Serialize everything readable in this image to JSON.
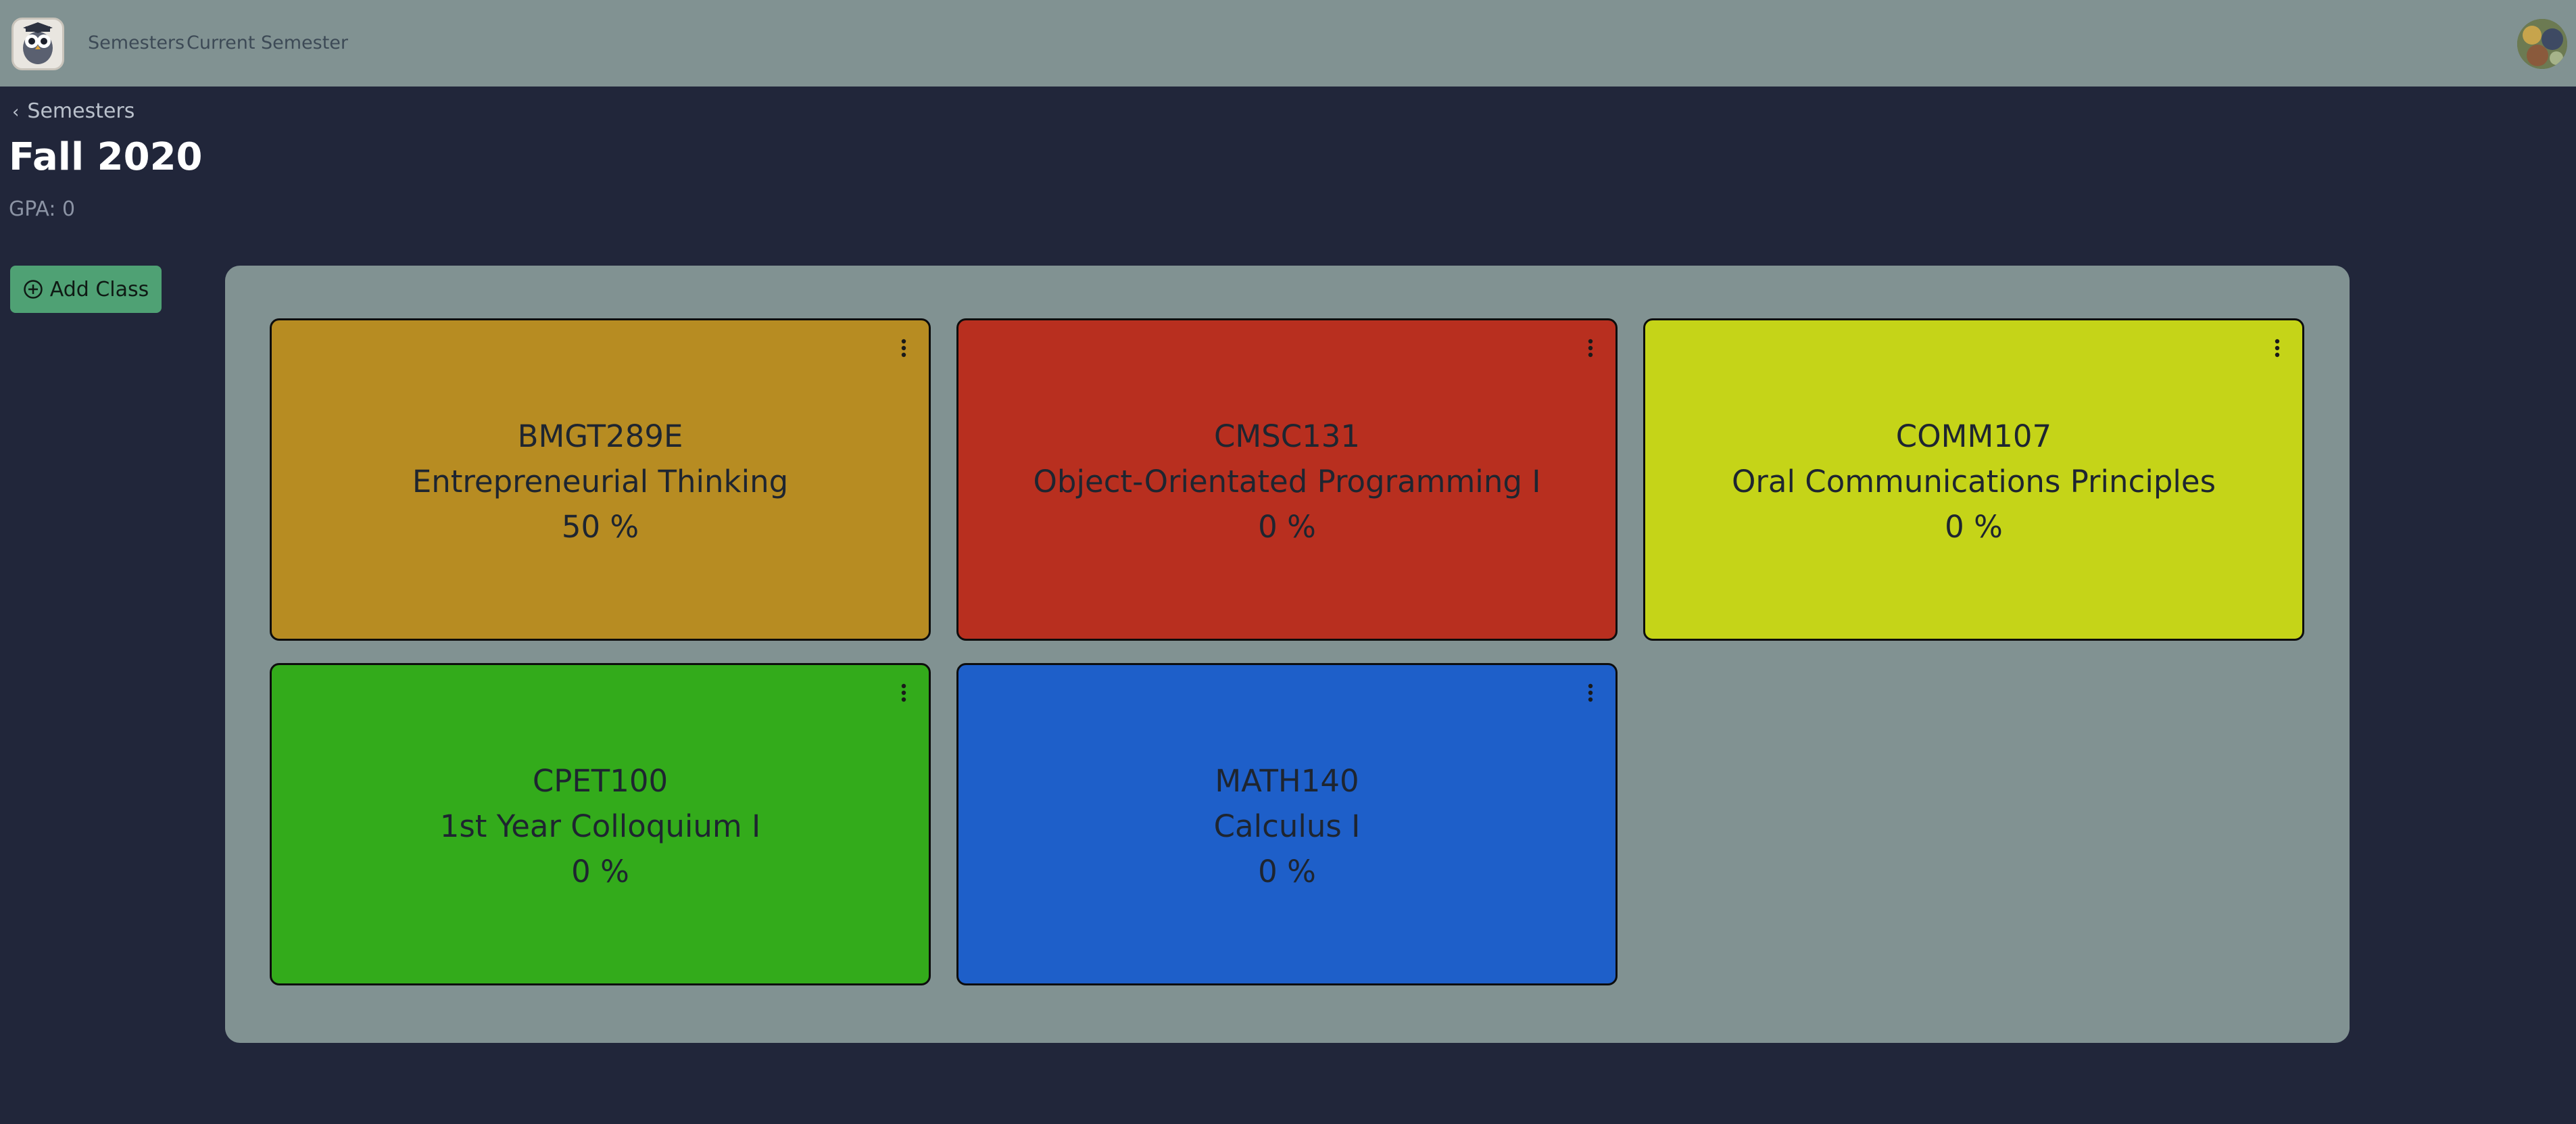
{
  "nav": {
    "links": [
      "Semesters",
      "Current Semester"
    ]
  },
  "breadcrumb": {
    "label": "Semesters"
  },
  "page": {
    "title": "Fall 2020",
    "gpa": "GPA: 0"
  },
  "actions": {
    "add_class_label": "Add Class"
  },
  "classes": [
    {
      "code": "BMGT289E",
      "name": "Entrepreneurial Thinking",
      "grade": "50 %",
      "color": "#b78c22"
    },
    {
      "code": "CMSC131",
      "name": "Object-Orientated Programming I",
      "grade": "0 %",
      "color": "#b82f1f"
    },
    {
      "code": "COMM107",
      "name": "Oral Communications Principles",
      "grade": "0 %",
      "color": "#c5d418"
    },
    {
      "code": "CPET100",
      "name": "1st Year Colloquium I",
      "grade": "0 %",
      "color": "#33ab1b"
    },
    {
      "code": "MATH140",
      "name": "Calculus I",
      "grade": "0 %",
      "color": "#1e5fc9"
    }
  ],
  "colors": {
    "navbar": "#819292",
    "background": "#21263a",
    "board": "#819292",
    "add_button": "#4fa174"
  },
  "icons": {
    "add": "plus-circle-icon",
    "menu": "vertical-dots-icon",
    "back": "chevron-left-icon"
  }
}
